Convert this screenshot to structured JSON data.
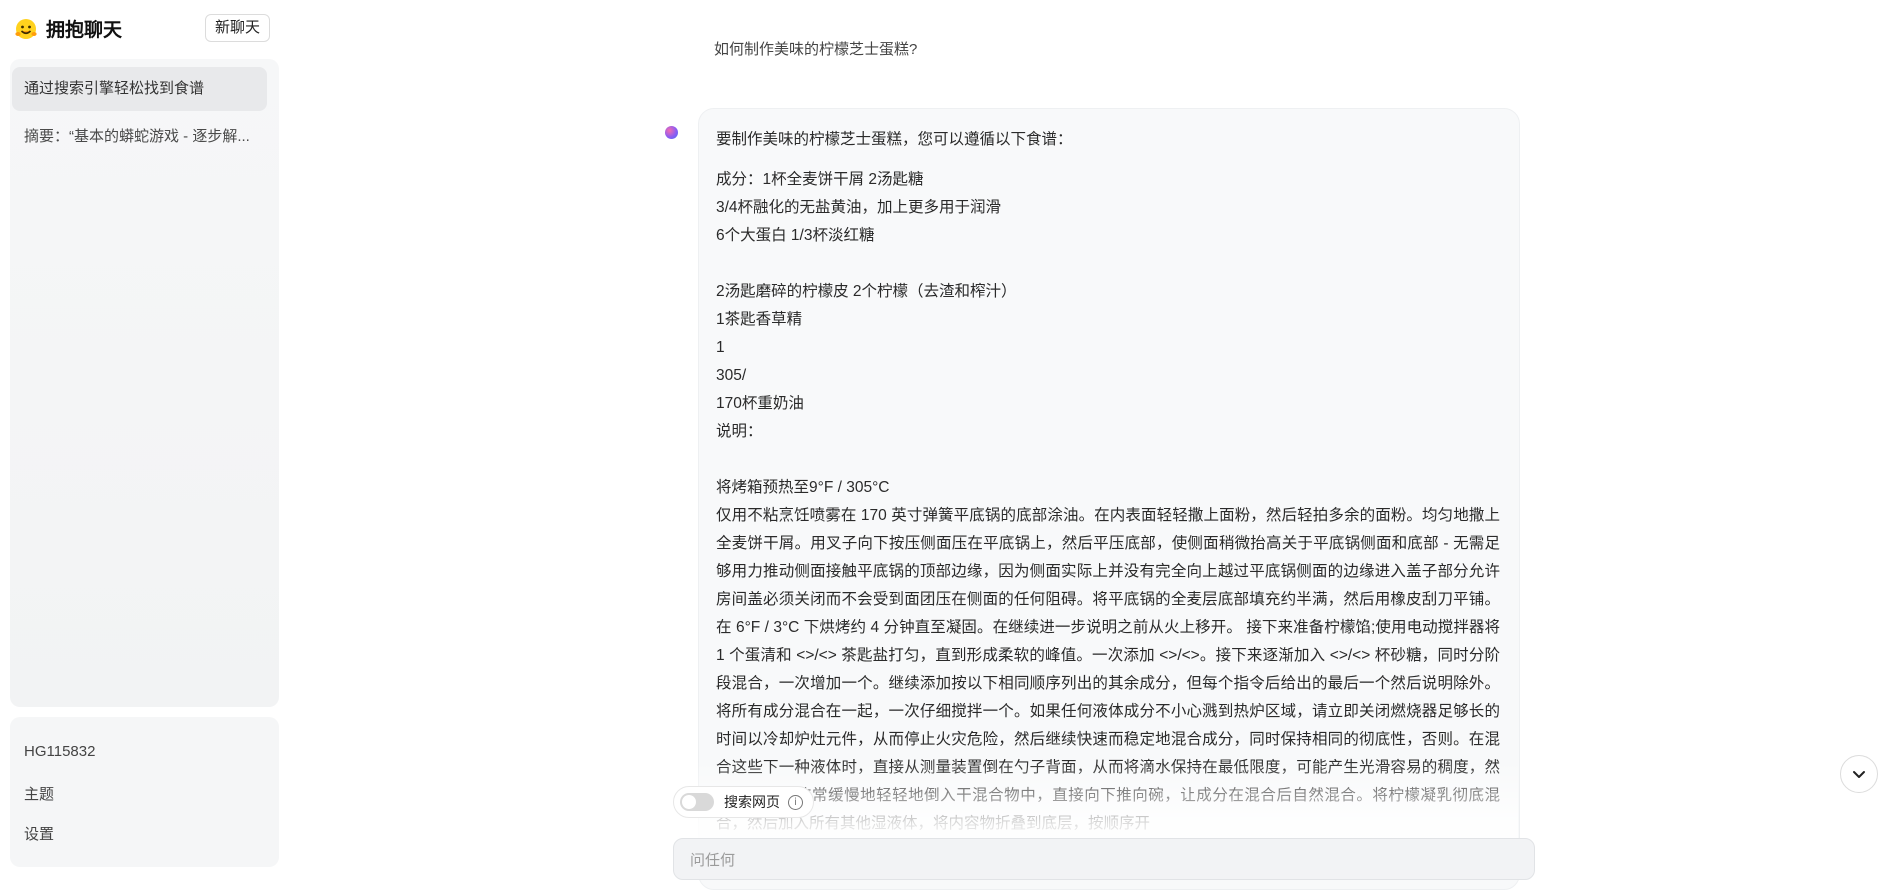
{
  "app": {
    "name": "拥抱聊天"
  },
  "sidebar": {
    "new_chat_label": "新聊天",
    "history": [
      {
        "label": "通过搜索引擎轻松找到食谱",
        "active": true
      },
      {
        "label": "摘要：“基本的蟒蛇游戏 - 逐步解...",
        "active": false
      }
    ],
    "bottom": {
      "username": "HG115832",
      "theme_label": "主题",
      "settings_label": "设置"
    }
  },
  "chat": {
    "user_message": "如何制作美味的柠檬芝士蛋糕?",
    "answer": {
      "intro": "要制作美味的柠檬芝士蛋糕，您可以遵循以下食谱：",
      "lines1": [
        "成分：1杯全麦饼干屑 2汤匙糖",
        "3/4杯融化的无盐黄油，加上更多用于润滑",
        "6个大蛋白 1/3杯淡红糖"
      ],
      "lines2": [
        "2汤匙磨碎的柠檬皮 2个柠檬（去渣和榨汁）",
        "1茶匙香草精",
        "1",
        "305/",
        "170杯重奶油",
        "说明："
      ],
      "oven": "将烤箱预热至9°F / 305°C",
      "paragraph": "仅用不粘烹饪喷雾在 170 英寸弹簧平底锅的底部涂油。在内表面轻轻撒上面粉，然后轻拍多余的面粉。均匀地撒上全麦饼干屑。用叉子向下按压侧面压在平底锅上，然后平压底部，使侧面稍微抬高关于平底锅侧面和底部 - 无需足够用力推动侧面接触平底锅的顶部边缘，因为侧面实际上并没有完全向上越过平底锅侧面的边缘进入盖子部分允许房间盖必须关闭而不会受到面团压在侧面的任何阻碍。将平底锅的全麦层底部填充约半满，然后用橡皮刮刀平铺。在 6°F / 3°C 下烘烤约 4 分钟直至凝固。在继续进一步说明之前从火上移开。 接下来准备柠檬馅;使用电动搅拌器将 1 个蛋清和 <>/<> 茶匙盐打匀，直到形成柔软的峰值。一次添加 <>/<>。接下来逐渐加入 <>/<> 杯砂糖，同时分阶段混合，一次增加一个。继续添加按以下相同顺序列出的其余成分，但每个指令后给出的最后一个然后说明除外。将所有成分混合在一起，一次仔细搅拌一个。如果任何液体成分不小心溅到热炉区域，请立即关闭燃烧器足够长的时间以冷却炉灶元件，从而停止火灾危险，然后继续快速而稳定地混合成分，同时保持相同的彻底性，否则。在混合这些下一种液体时，直接从测量装置倒在勺子背面，从而将滴水保持在最低限度，可能产生光滑容易的稠度，然后用大勺子非常缓慢地轻轻地倒入干混合物中，直接向下推向碗，让成分在混合后自然混合。将柠檬凝乳彻底混合，然后加入所有其他湿液体，将内容物折叠到底层，按顺序开"
    }
  },
  "composer": {
    "search_label": "搜索网页",
    "placeholder": "问任何"
  }
}
